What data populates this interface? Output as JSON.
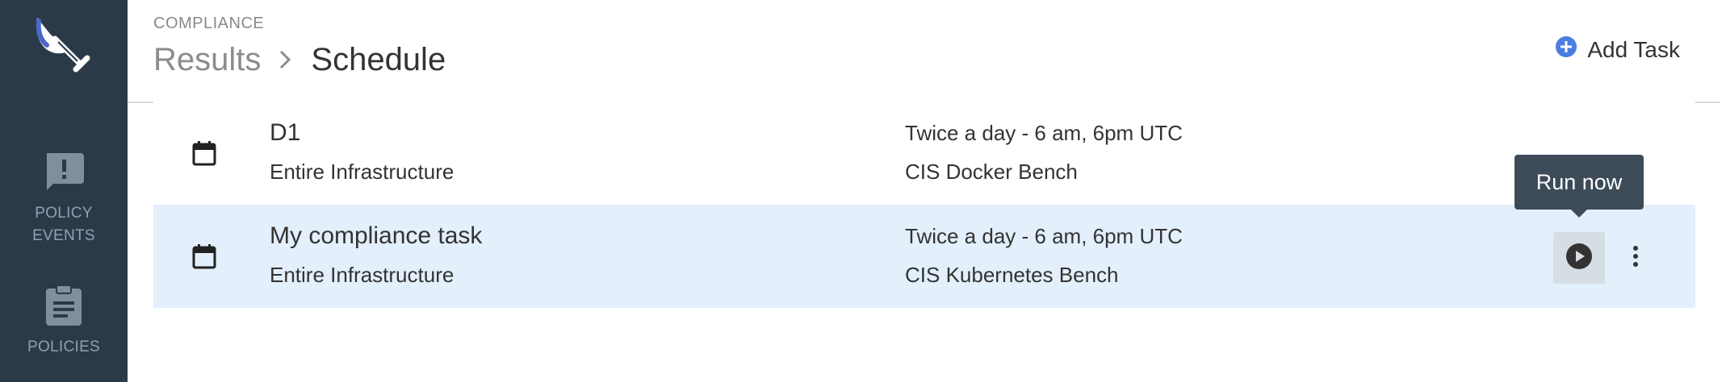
{
  "sidebar": {
    "logo": "shovel-logo",
    "items": [
      {
        "label_line1": "POLICY",
        "label_line2": "EVENTS",
        "icon": "alert-message-icon"
      },
      {
        "label": "POLICIES",
        "icon": "clipboard-icon"
      }
    ]
  },
  "header": {
    "section": "COMPLIANCE",
    "breadcrumb": {
      "parent": "Results",
      "separator": "chevron-right-icon",
      "current": "Schedule"
    },
    "add_task_label": "Add Task"
  },
  "tasks": [
    {
      "name": "D1",
      "scope": "Entire Infrastructure",
      "schedule": "Twice a day - 6 am, 6pm UTC",
      "benchmark": "CIS Docker Bench",
      "icon": "calendar-icon",
      "highlighted": false
    },
    {
      "name": "My compliance task",
      "scope": "Entire Infrastructure",
      "schedule": "Twice a day - 6 am, 6pm UTC",
      "benchmark": "CIS Kubernetes Bench",
      "icon": "calendar-icon",
      "highlighted": true
    }
  ],
  "tooltip": {
    "text": "Run now"
  },
  "colors": {
    "sidebar_bg": "#2b3a48",
    "accent_blue": "#4a7de0",
    "row_highlight": "#e3effb",
    "tooltip_bg": "#3d4b59"
  }
}
